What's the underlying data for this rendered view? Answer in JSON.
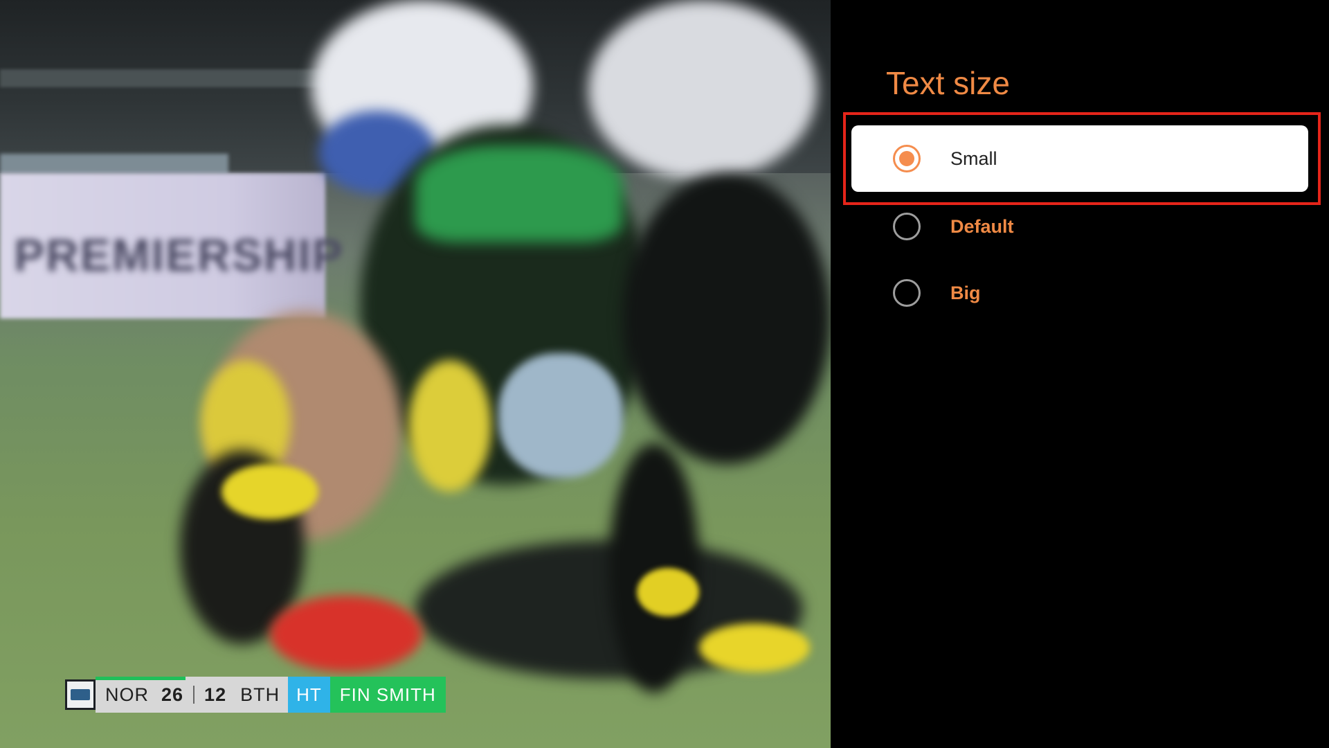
{
  "video": {
    "ad_board_text": "PREMIERSHIP",
    "scoreboard": {
      "home_team": "NOR",
      "home_score": "26",
      "away_score": "12",
      "away_team": "BTH",
      "period": "HT",
      "caption": "FIN SMITH",
      "colors": {
        "period_bg": "#2fb3e8",
        "caption_bg": "#24c25a",
        "score_bg": "#d7d7d7"
      }
    }
  },
  "panel": {
    "title": "Text size",
    "options": [
      {
        "label": "Small",
        "selected": true,
        "focused": true
      },
      {
        "label": "Default",
        "selected": false,
        "focused": false
      },
      {
        "label": "Big",
        "selected": false,
        "focused": false
      }
    ],
    "colors": {
      "accent": "#f58d4e",
      "focus_ring": "#e5251a",
      "background": "#000000"
    }
  }
}
